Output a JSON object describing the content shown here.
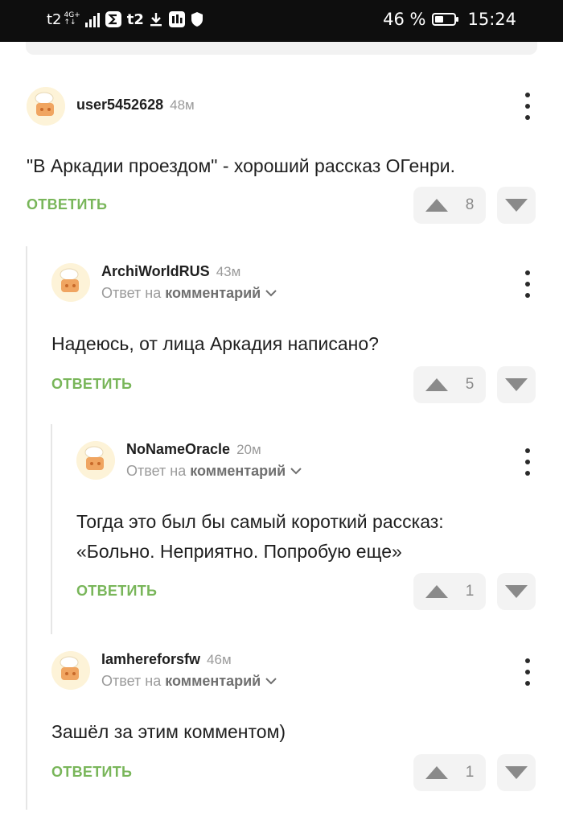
{
  "status_bar": {
    "carrier_left": "t2",
    "network_top": "4G+",
    "network_bottom": "↑↓",
    "carrier_2": "t2",
    "battery_percent": "46 %",
    "battery_level": 0.46,
    "time": "15:24",
    "icons": [
      "signal-bars-icon",
      "sigma-app-icon",
      "t2-app-icon",
      "download-icon",
      "mts-app-icon",
      "shield-icon",
      "battery-icon"
    ]
  },
  "comments": [
    {
      "author": "user5452628",
      "time": "48м",
      "reply_to": null,
      "lines": [
        "\"В Аркадии проездом\" - хороший рассказ ОГенри."
      ],
      "reply_label": "ОТВЕТИТЬ",
      "votes": "8"
    },
    {
      "author": "ArchiWorldRUS",
      "time": "43м",
      "reply_to": {
        "prefix": "Ответ на",
        "target": "комментарий"
      },
      "lines": [
        "Надеюсь, от лица Аркадия написано?"
      ],
      "reply_label": "ОТВЕТИТЬ",
      "votes": "5"
    },
    {
      "author": "NoNameOracle",
      "time": "20м",
      "reply_to": {
        "prefix": "Ответ на",
        "target": "комментарий"
      },
      "lines": [
        "Тогда это был бы самый короткий рассказ:",
        "«Больно. Неприятно. Попробую еще»"
      ],
      "reply_label": "ОТВЕТИТЬ",
      "votes": "1"
    },
    {
      "author": "Iamhereforsfw",
      "time": "46м",
      "reply_to": {
        "prefix": "Ответ на",
        "target": "комментарий"
      },
      "lines": [
        "Зашёл за этим комментом)"
      ],
      "reply_label": "ОТВЕТИТЬ",
      "votes": "1"
    }
  ],
  "colors": {
    "accent": "#79b65a",
    "muted_text": "#9a9a9a",
    "vote_bg": "#f3f3f3",
    "status_bar_bg": "#0e0e0e"
  }
}
